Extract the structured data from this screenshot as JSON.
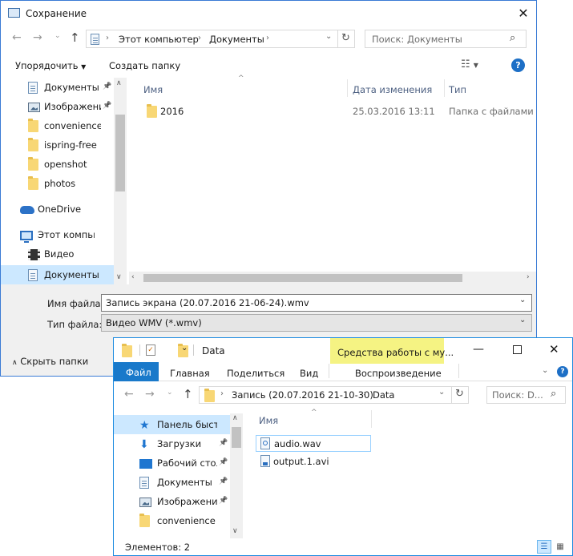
{
  "save": {
    "title": "Сохранение",
    "address": [
      "Этот компьютер",
      "Документы"
    ],
    "search_placeholder": "Поиск: Документы",
    "toolbar": {
      "organize": "Упорядочить",
      "new_folder": "Создать папку"
    },
    "nav": [
      {
        "label": "Документы",
        "icon": "doc",
        "pin": true
      },
      {
        "label": "Изображени",
        "icon": "img",
        "pin": true
      },
      {
        "label": "convenience",
        "icon": "folder"
      },
      {
        "label": "ispring-free",
        "icon": "folder"
      },
      {
        "label": "openshot",
        "icon": "folder"
      },
      {
        "label": "photos",
        "icon": "folder"
      },
      {
        "label": "OneDrive",
        "icon": "cloud"
      },
      {
        "label": "Этот компьютер",
        "icon": "pc"
      },
      {
        "label": "Видео",
        "icon": "video"
      },
      {
        "label": "Документы",
        "icon": "doc",
        "selected": true
      }
    ],
    "columns": {
      "name": "Имя",
      "date": "Дата изменения",
      "type": "Тип"
    },
    "files": [
      {
        "name": "2016",
        "date": "25.03.2016 13:11",
        "type": "Папка с файлами"
      }
    ],
    "filename_label": "Имя файла:",
    "filename_value": "Запись экрана (20.07.2016 21-06-24).wmv",
    "filetype_label": "Тип файла:",
    "filetype_value": "Видео WMV (*.wmv)",
    "hide_folders": "Скрыть папки"
  },
  "explorer": {
    "title": "Data",
    "context_tab": "Средства работы с му...",
    "tabs": [
      "Файл",
      "Главная",
      "Поделиться",
      "Вид",
      "Воспроизведение"
    ],
    "address": [
      "Запись (20.07.2016 21-10-30)",
      "Data"
    ],
    "search_placeholder": "Поиск: D...",
    "nav": [
      {
        "label": "Панель быстрого",
        "icon": "star",
        "selected": true
      },
      {
        "label": "Загрузки",
        "icon": "down",
        "pin": true
      },
      {
        "label": "Рабочий стол",
        "icon": "desk",
        "pin": true
      },
      {
        "label": "Документы",
        "icon": "doc",
        "pin": true
      },
      {
        "label": "Изображения",
        "icon": "img",
        "pin": true
      },
      {
        "label": "convenience",
        "icon": "folder"
      }
    ],
    "column_name": "Имя",
    "files": [
      {
        "name": "audio.wav",
        "icon": "audio"
      },
      {
        "name": "output.1.avi",
        "icon": "avi"
      }
    ],
    "status": "Элементов: 2"
  }
}
